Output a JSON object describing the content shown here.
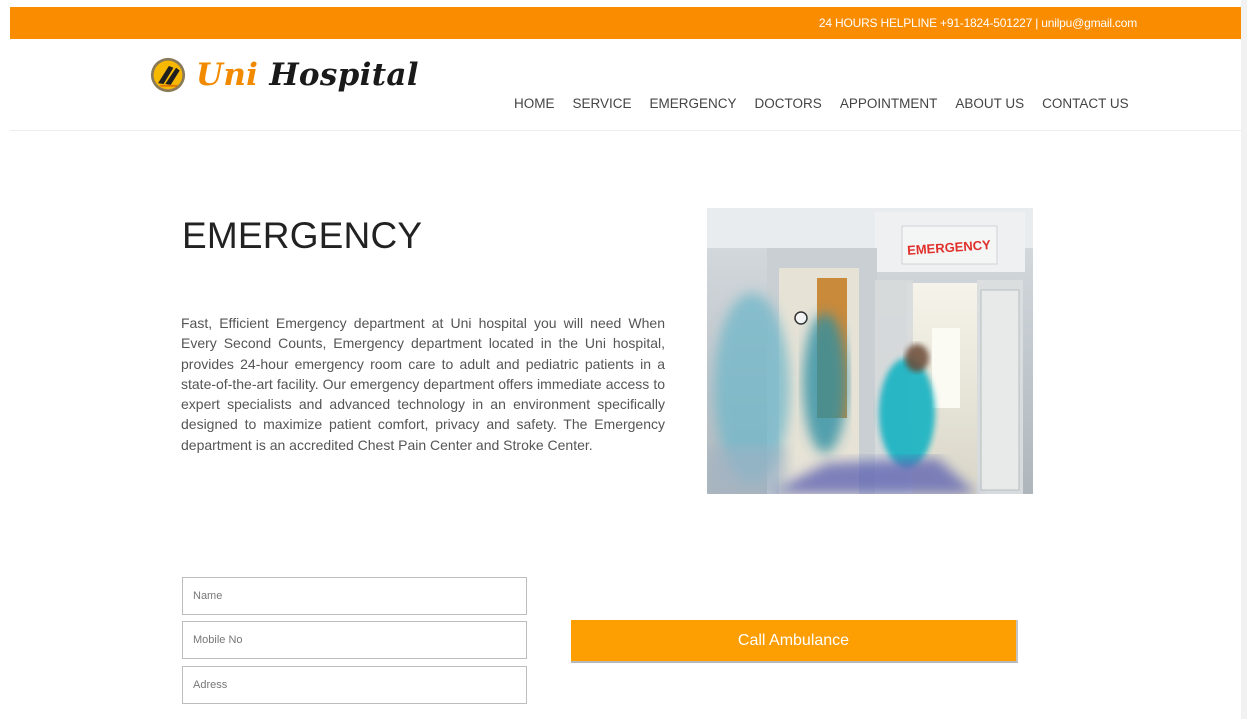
{
  "topbar": {
    "helpline": "24 HOURS HELPLINE +91-1824-501227 | unilpu@gmail.com",
    "background": "#fa8c00"
  },
  "logo": {
    "word1": "Uni",
    "word2": "Hospital",
    "accent_color": "#f28a00",
    "icon": "lpu-emblem-icon"
  },
  "nav": {
    "items": [
      {
        "label": "HOME"
      },
      {
        "label": "SERVICE"
      },
      {
        "label": "EMERGENCY"
      },
      {
        "label": "DOCTORS"
      },
      {
        "label": "APPOINTMENT"
      },
      {
        "label": "ABOUT US"
      },
      {
        "label": "CONTACT US"
      }
    ]
  },
  "emergency": {
    "title": "EMERGENCY",
    "description": "Fast, Efficient Emergency department at Uni hospital you will need When Every Second Counts, Emergency department located in the Uni hospital, provides 24-hour emergency room care to adult and pediatric patients in a state-of-the-art facility. Our emergency department offers immediate access to expert specialists and advanced technology in an environment specifically designed to maximize patient comfort, privacy and safety. The Emergency department is an accredited Chest Pain Center and Stroke Center.",
    "photo_sign": "EMERGENCY"
  },
  "form": {
    "name_placeholder": "Name",
    "mobile_placeholder": "Mobile No",
    "address_placeholder": "Adress",
    "name_value": "",
    "mobile_value": "",
    "address_value": ""
  },
  "call_button": {
    "label": "Call Ambulance",
    "color": "#fd9e02"
  }
}
